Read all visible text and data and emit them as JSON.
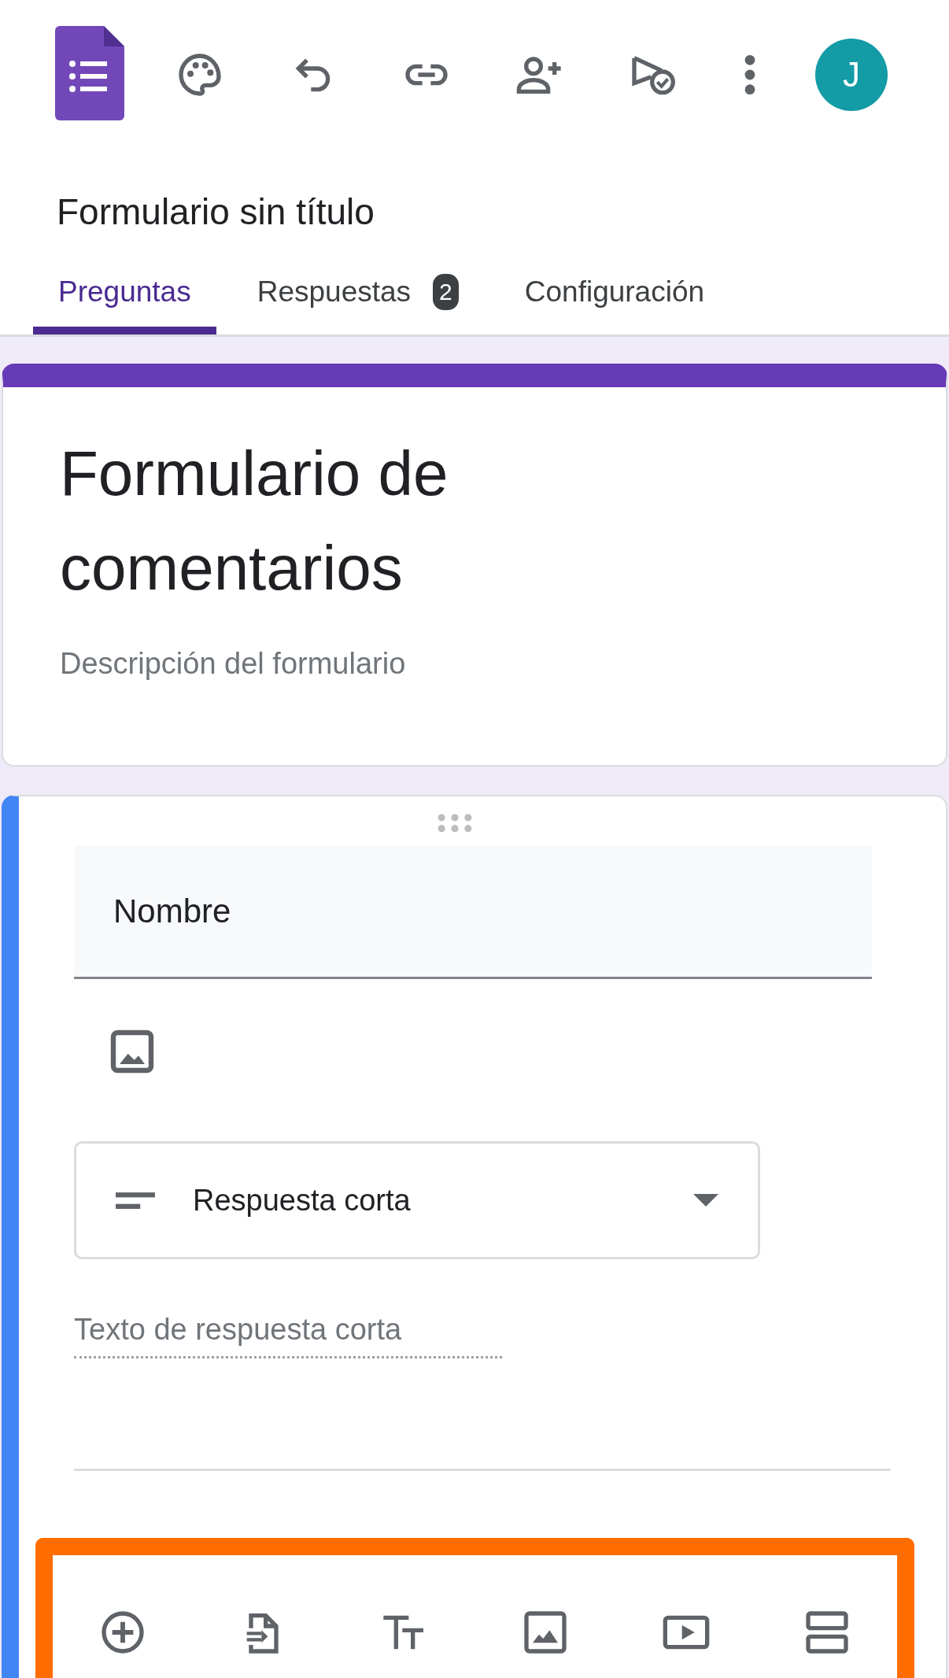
{
  "header": {
    "avatar": "J"
  },
  "form_title": "Formulario sin título",
  "tabs": [
    {
      "label": "Preguntas",
      "selected": true
    },
    {
      "label": "Respuestas",
      "selected": false,
      "badge": "2"
    },
    {
      "label": "Configuración",
      "selected": false
    }
  ],
  "title_card": {
    "title": "Formulario de comentarios",
    "description": "Descripción del formulario"
  },
  "question": {
    "title": "Nombre",
    "type": "Respuesta corta",
    "answer_placeholder": "Texto de respuesta corta"
  },
  "toolbar": {
    "highlighted": true
  }
}
